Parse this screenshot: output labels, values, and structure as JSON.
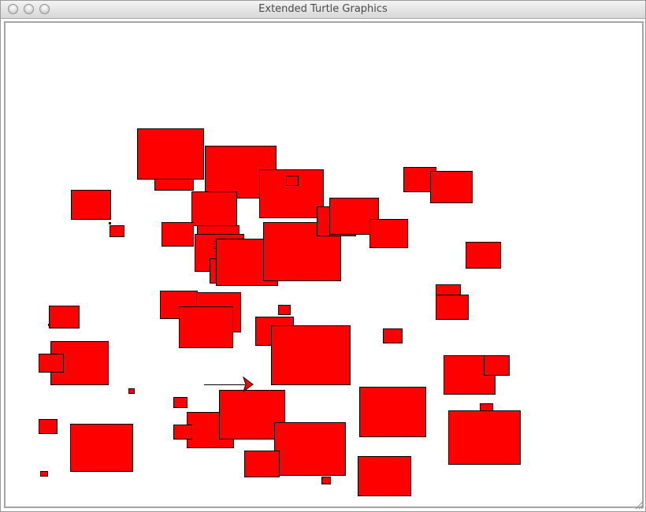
{
  "window": {
    "title": "Extended Turtle Graphics"
  },
  "icons": {
    "close": "close-icon",
    "minimize": "minimize-icon",
    "zoom": "zoom-icon",
    "turtle": "turtle-arrow-icon",
    "resize": "resize-grip-icon"
  },
  "colors": {
    "fill": "#ff0000",
    "stroke": "#000000",
    "background": "#ffffff"
  }
}
